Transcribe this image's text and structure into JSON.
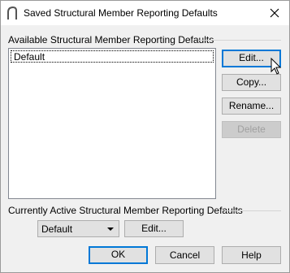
{
  "window": {
    "title": "Saved Structural Member Reporting Defaults",
    "app_icon": "chief-architect-arch-icon",
    "close_icon": "close-icon"
  },
  "available_group": {
    "label": "Available Structural Member Reporting Defaults",
    "items": [
      "Default"
    ],
    "selected_index": 0
  },
  "side_buttons": {
    "edit": "Edit...",
    "copy": "Copy...",
    "rename": "Rename...",
    "delete": "Delete"
  },
  "active_group": {
    "label": "Currently Active Structural Member Reporting Defaults",
    "selected_value": "Default",
    "edit": "Edit..."
  },
  "footer": {
    "ok": "OK",
    "cancel": "Cancel",
    "help": "Help"
  },
  "colors": {
    "accent": "#0078d7",
    "dialog_bg": "#f0f0f0",
    "button_bg": "#e1e1e1"
  }
}
